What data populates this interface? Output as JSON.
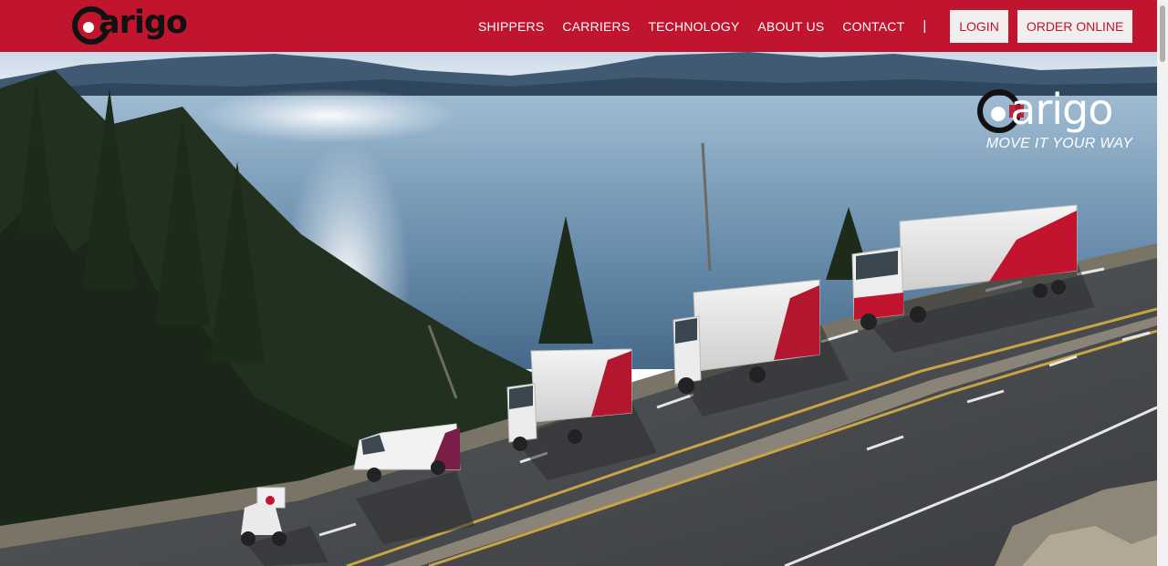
{
  "brand": {
    "name": "Carigo",
    "tagline": "MOVE IT YOUR WAY",
    "primary_color": "#c1152f"
  },
  "nav": {
    "items": [
      {
        "label": "SHIPPERS"
      },
      {
        "label": "CARRIERS"
      },
      {
        "label": "TECHNOLOGY"
      },
      {
        "label": "ABOUT US"
      },
      {
        "label": "CONTACT"
      }
    ],
    "separator": "|",
    "login_label": "LOGIN",
    "order_label": "ORDER ONLINE"
  }
}
